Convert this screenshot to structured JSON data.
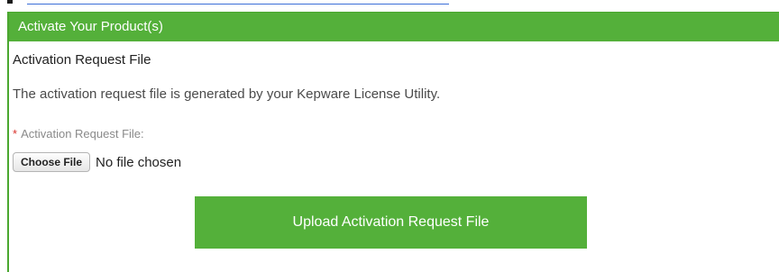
{
  "panel": {
    "header_title": "Activate Your Product(s)"
  },
  "activation": {
    "section_title": "Activation Request File",
    "description": "The activation request file is generated by your Kepware License Utility.",
    "required_marker": "*",
    "field_label": "Activation Request File:",
    "choose_button_label": "Choose File",
    "file_status": "No file chosen",
    "upload_button_label": "Upload Activation Request File"
  },
  "colors": {
    "brand_green": "#54b03a",
    "required_red": "#d9302a",
    "link_blue": "#3b6fd8"
  }
}
